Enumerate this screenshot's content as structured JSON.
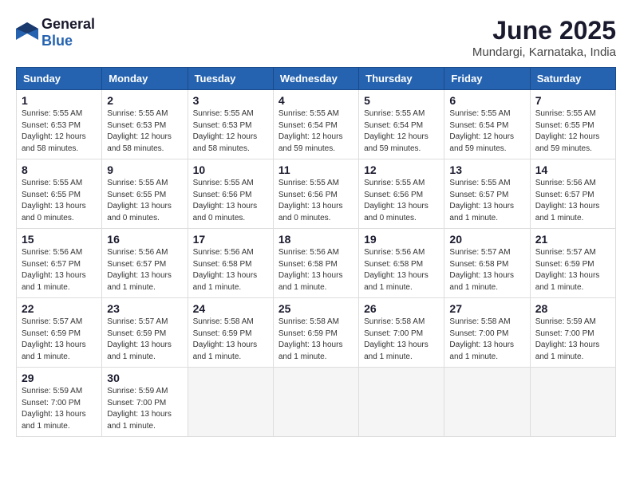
{
  "logo": {
    "general": "General",
    "blue": "Blue"
  },
  "title": "June 2025",
  "location": "Mundargi, Karnataka, India",
  "headers": [
    "Sunday",
    "Monday",
    "Tuesday",
    "Wednesday",
    "Thursday",
    "Friday",
    "Saturday"
  ],
  "weeks": [
    [
      {
        "day": "1",
        "info": "Sunrise: 5:55 AM\nSunset: 6:53 PM\nDaylight: 12 hours\nand 58 minutes."
      },
      {
        "day": "2",
        "info": "Sunrise: 5:55 AM\nSunset: 6:53 PM\nDaylight: 12 hours\nand 58 minutes."
      },
      {
        "day": "3",
        "info": "Sunrise: 5:55 AM\nSunset: 6:53 PM\nDaylight: 12 hours\nand 58 minutes."
      },
      {
        "day": "4",
        "info": "Sunrise: 5:55 AM\nSunset: 6:54 PM\nDaylight: 12 hours\nand 59 minutes."
      },
      {
        "day": "5",
        "info": "Sunrise: 5:55 AM\nSunset: 6:54 PM\nDaylight: 12 hours\nand 59 minutes."
      },
      {
        "day": "6",
        "info": "Sunrise: 5:55 AM\nSunset: 6:54 PM\nDaylight: 12 hours\nand 59 minutes."
      },
      {
        "day": "7",
        "info": "Sunrise: 5:55 AM\nSunset: 6:55 PM\nDaylight: 12 hours\nand 59 minutes."
      }
    ],
    [
      {
        "day": "8",
        "info": "Sunrise: 5:55 AM\nSunset: 6:55 PM\nDaylight: 13 hours\nand 0 minutes."
      },
      {
        "day": "9",
        "info": "Sunrise: 5:55 AM\nSunset: 6:55 PM\nDaylight: 13 hours\nand 0 minutes."
      },
      {
        "day": "10",
        "info": "Sunrise: 5:55 AM\nSunset: 6:56 PM\nDaylight: 13 hours\nand 0 minutes."
      },
      {
        "day": "11",
        "info": "Sunrise: 5:55 AM\nSunset: 6:56 PM\nDaylight: 13 hours\nand 0 minutes."
      },
      {
        "day": "12",
        "info": "Sunrise: 5:55 AM\nSunset: 6:56 PM\nDaylight: 13 hours\nand 0 minutes."
      },
      {
        "day": "13",
        "info": "Sunrise: 5:55 AM\nSunset: 6:57 PM\nDaylight: 13 hours\nand 1 minute."
      },
      {
        "day": "14",
        "info": "Sunrise: 5:56 AM\nSunset: 6:57 PM\nDaylight: 13 hours\nand 1 minute."
      }
    ],
    [
      {
        "day": "15",
        "info": "Sunrise: 5:56 AM\nSunset: 6:57 PM\nDaylight: 13 hours\nand 1 minute."
      },
      {
        "day": "16",
        "info": "Sunrise: 5:56 AM\nSunset: 6:57 PM\nDaylight: 13 hours\nand 1 minute."
      },
      {
        "day": "17",
        "info": "Sunrise: 5:56 AM\nSunset: 6:58 PM\nDaylight: 13 hours\nand 1 minute."
      },
      {
        "day": "18",
        "info": "Sunrise: 5:56 AM\nSunset: 6:58 PM\nDaylight: 13 hours\nand 1 minute."
      },
      {
        "day": "19",
        "info": "Sunrise: 5:56 AM\nSunset: 6:58 PM\nDaylight: 13 hours\nand 1 minute."
      },
      {
        "day": "20",
        "info": "Sunrise: 5:57 AM\nSunset: 6:58 PM\nDaylight: 13 hours\nand 1 minute."
      },
      {
        "day": "21",
        "info": "Sunrise: 5:57 AM\nSunset: 6:59 PM\nDaylight: 13 hours\nand 1 minute."
      }
    ],
    [
      {
        "day": "22",
        "info": "Sunrise: 5:57 AM\nSunset: 6:59 PM\nDaylight: 13 hours\nand 1 minute."
      },
      {
        "day": "23",
        "info": "Sunrise: 5:57 AM\nSunset: 6:59 PM\nDaylight: 13 hours\nand 1 minute."
      },
      {
        "day": "24",
        "info": "Sunrise: 5:58 AM\nSunset: 6:59 PM\nDaylight: 13 hours\nand 1 minute."
      },
      {
        "day": "25",
        "info": "Sunrise: 5:58 AM\nSunset: 6:59 PM\nDaylight: 13 hours\nand 1 minute."
      },
      {
        "day": "26",
        "info": "Sunrise: 5:58 AM\nSunset: 7:00 PM\nDaylight: 13 hours\nand 1 minute."
      },
      {
        "day": "27",
        "info": "Sunrise: 5:58 AM\nSunset: 7:00 PM\nDaylight: 13 hours\nand 1 minute."
      },
      {
        "day": "28",
        "info": "Sunrise: 5:59 AM\nSunset: 7:00 PM\nDaylight: 13 hours\nand 1 minute."
      }
    ],
    [
      {
        "day": "29",
        "info": "Sunrise: 5:59 AM\nSunset: 7:00 PM\nDaylight: 13 hours\nand 1 minute."
      },
      {
        "day": "30",
        "info": "Sunrise: 5:59 AM\nSunset: 7:00 PM\nDaylight: 13 hours\nand 1 minute."
      },
      null,
      null,
      null,
      null,
      null
    ]
  ]
}
